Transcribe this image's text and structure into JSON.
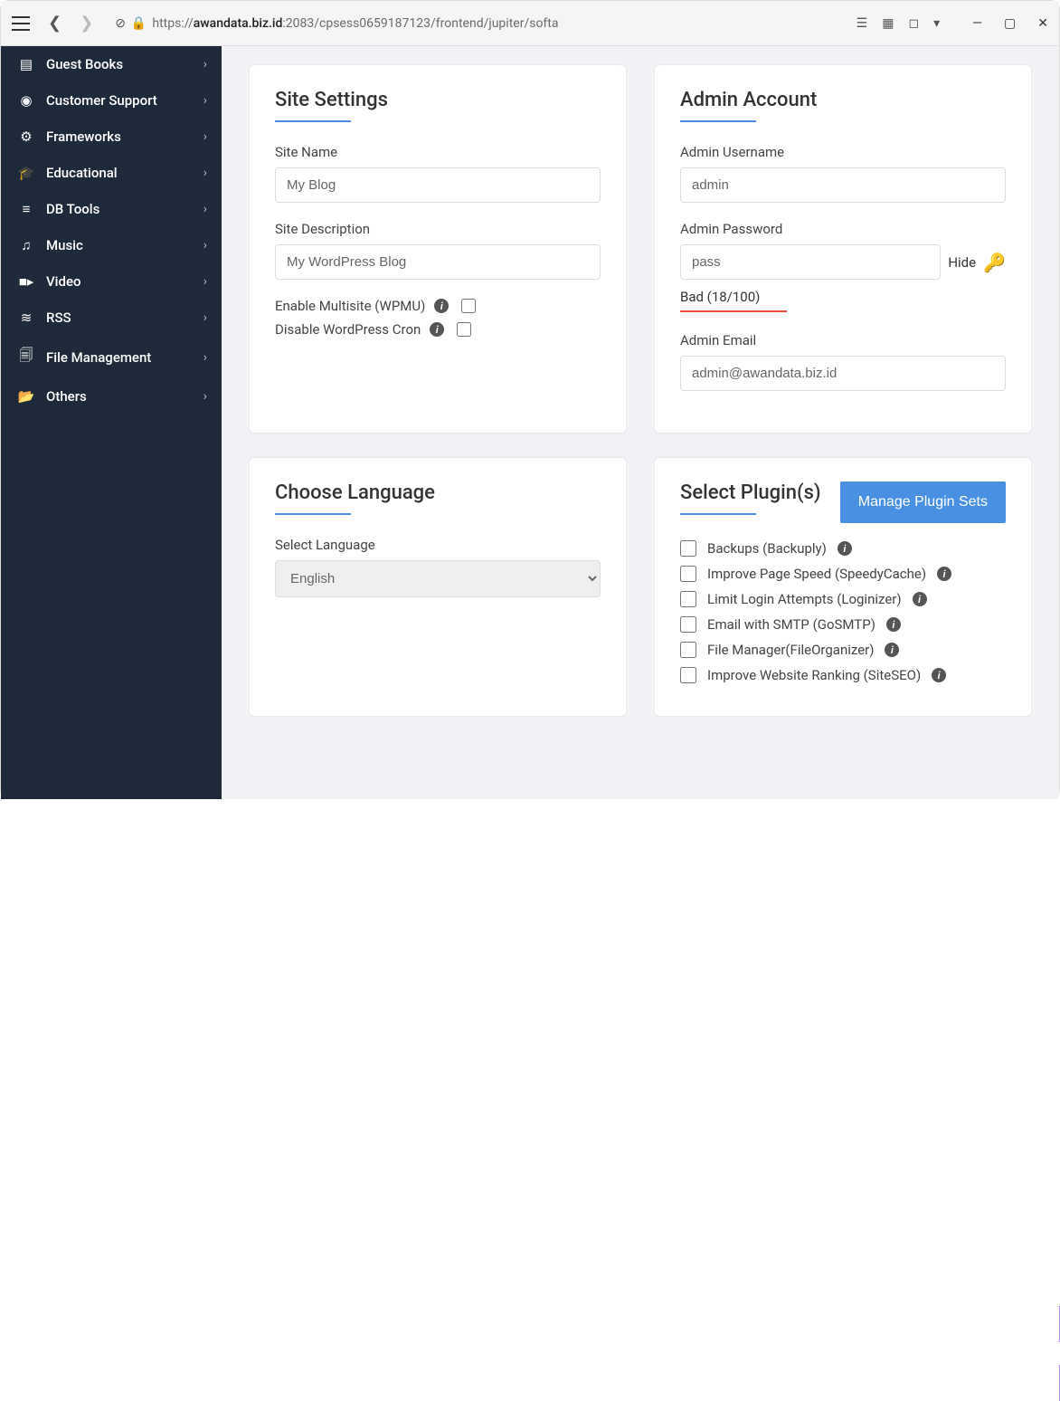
{
  "browser": {
    "url_host": "awandata.biz.id",
    "url_path": ":2083/cpsess0659187123/frontend/jupiter/softa"
  },
  "sidebar": {
    "items": [
      {
        "icon": "book",
        "label": "Guest Books"
      },
      {
        "icon": "support",
        "label": "Customer Support"
      },
      {
        "icon": "gears",
        "label": "Frameworks"
      },
      {
        "icon": "graduation",
        "label": "Educational"
      },
      {
        "icon": "database",
        "label": "DB Tools"
      },
      {
        "icon": "music",
        "label": "Music"
      },
      {
        "icon": "video",
        "label": "Video"
      },
      {
        "icon": "rss",
        "label": "RSS"
      },
      {
        "icon": "files",
        "label": "File Management"
      },
      {
        "icon": "folder",
        "label": "Others"
      }
    ]
  },
  "site_settings": {
    "title": "Site Settings",
    "site_name_label": "Site Name",
    "site_name_value": "My Blog",
    "site_desc_label": "Site Description",
    "site_desc_value": "My WordPress Blog",
    "multisite_label": "Enable Multisite (WPMU)",
    "cron_label": "Disable WordPress Cron"
  },
  "admin_account": {
    "title": "Admin Account",
    "username_label": "Admin Username",
    "username_value": "admin",
    "password_label": "Admin Password",
    "password_value": "pass",
    "hide_label": "Hide",
    "strength_text": "Bad (18/100)",
    "email_label": "Admin Email",
    "email_value": "admin@awandata.biz.id"
  },
  "language": {
    "title": "Choose Language",
    "select_label": "Select Language",
    "selected": "English"
  },
  "plugins": {
    "title": "Select Plugin(s)",
    "manage_btn": "Manage Plugin Sets",
    "items": [
      "Backups (Backuply)",
      "Improve Page Speed (SpeedyCache)",
      "Limit Login Attempts (Loginizer)",
      "Email with SMTP (GoSMTP)",
      "File Manager(FileOrganizer)",
      "Improve Website Ranking (SiteSEO)"
    ]
  }
}
